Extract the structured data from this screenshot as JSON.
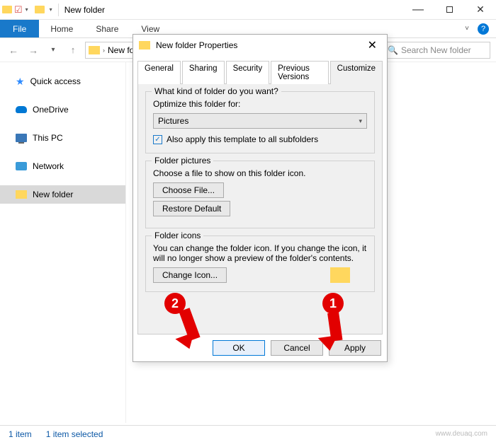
{
  "window": {
    "title": "New folder",
    "ribbon": {
      "file": "File",
      "home": "Home",
      "share": "Share",
      "view": "View"
    },
    "nav": {
      "crumb": "New fo",
      "search_placeholder": "Search New folder"
    }
  },
  "sidebar": {
    "quick": "Quick access",
    "onedrive": "OneDrive",
    "thispc": "This PC",
    "network": "Network",
    "newfolder": "New folder"
  },
  "dialog": {
    "title": "New folder Properties",
    "tabs": {
      "general": "General",
      "sharing": "Sharing",
      "security": "Security",
      "previous": "Previous Versions",
      "customize": "Customize"
    },
    "group1": {
      "legend": "What kind of folder do you want?",
      "label": "Optimize this folder for:",
      "select_value": "Pictures",
      "checkbox": "Also apply this template to all subfolders"
    },
    "group2": {
      "legend": "Folder pictures",
      "text": "Choose a file to show on this folder icon.",
      "choose": "Choose File...",
      "restore": "Restore Default"
    },
    "group3": {
      "legend": "Folder icons",
      "text": "You can change the folder icon. If you change the icon, it will no longer show a preview of the folder's contents.",
      "change": "Change Icon..."
    },
    "buttons": {
      "ok": "OK",
      "cancel": "Cancel",
      "apply": "Apply"
    }
  },
  "status": {
    "items": "1 item",
    "selected": "1 item selected",
    "watermark": "www.deuaq.com"
  },
  "anno": {
    "one": "1",
    "two": "2"
  }
}
